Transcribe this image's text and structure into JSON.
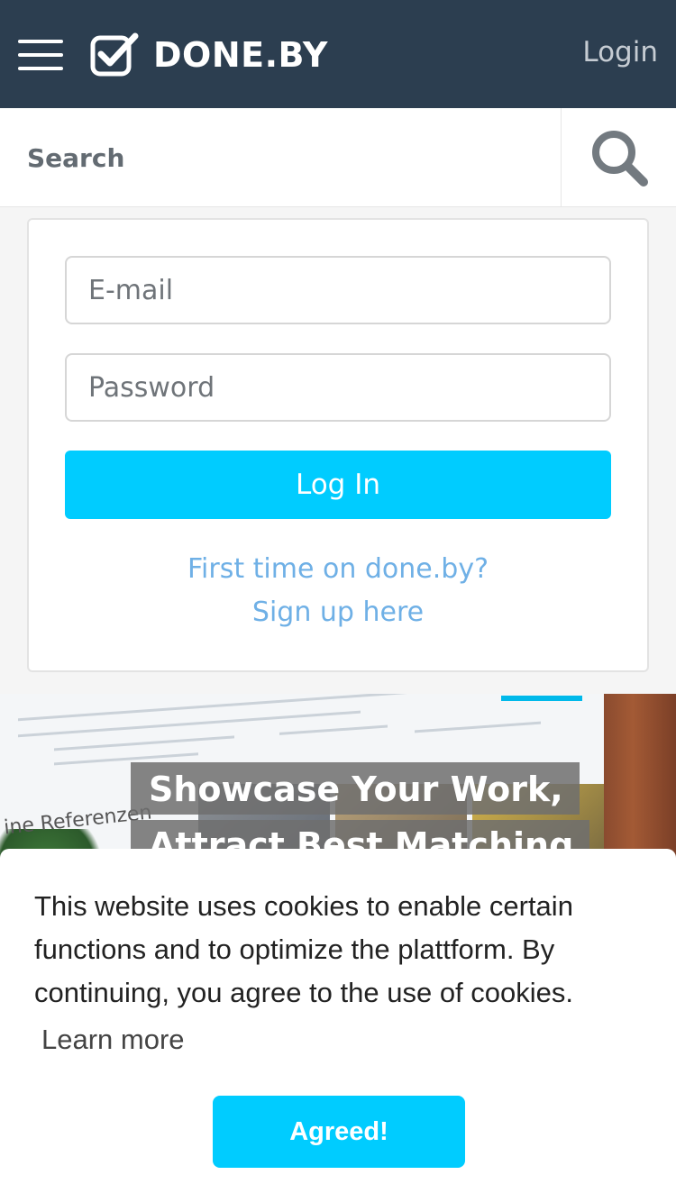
{
  "header": {
    "brand": "DONE.BY",
    "login_label": "Login",
    "menu_icon": "hamburger-menu-icon",
    "logo_icon": "checkbox-check-icon"
  },
  "search": {
    "placeholder": "Search",
    "button_icon": "search-icon"
  },
  "login_form": {
    "email_placeholder": "E-mail",
    "password_placeholder": "Password",
    "submit_label": "Log In",
    "first_time_text": "First time on done.by?",
    "signup_link": "Sign up here"
  },
  "hero": {
    "headline_line1": "Showcase Your Work,",
    "headline_line2": "Attract Best Matching",
    "screenshot_caption": "ine Referenzen"
  },
  "cookie_banner": {
    "message": "This website uses cookies to enable certain functions and to optimize the plattform. By continuing, you agree to the use of cookies.",
    "learn_more": "Learn more",
    "agree_label": "Agreed!"
  },
  "colors": {
    "header_bg": "#2c3e50",
    "accent": "#00ccff",
    "link": "#6fb0e6"
  }
}
